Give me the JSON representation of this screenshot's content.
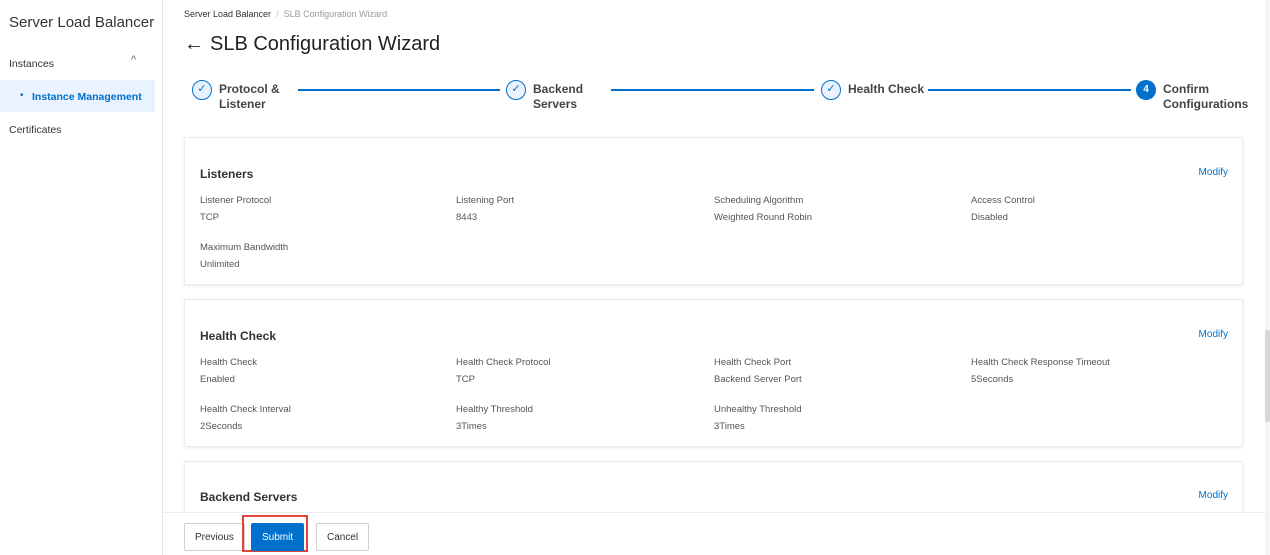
{
  "sidebar": {
    "title": "Server Load Balancer",
    "group_label": "Instances",
    "group_chevron": "^",
    "active_item": "Instance Management",
    "item_certificates": "Certificates"
  },
  "breadcrumb": {
    "root": "Server Load Balancer",
    "separator": "/",
    "current": "SLB Configuration Wizard"
  },
  "page": {
    "back_arrow": "←",
    "title": "SLB Configuration Wizard"
  },
  "steps": [
    {
      "line1": "Protocol &",
      "line2": "Listener",
      "status": "done",
      "icon": "✓"
    },
    {
      "line1": "Backend",
      "line2": "Servers",
      "status": "done",
      "icon": "✓"
    },
    {
      "line1": "Health Check",
      "line2": "",
      "status": "done",
      "icon": "✓"
    },
    {
      "line1": "Confirm",
      "line2": "Configurations",
      "status": "active",
      "icon": "4"
    }
  ],
  "listeners": {
    "title": "Listeners",
    "modify": "Modify",
    "fields": [
      {
        "label": "Listener Protocol",
        "value": "TCP"
      },
      {
        "label": "Listening Port",
        "value": "8443"
      },
      {
        "label": "Scheduling Algorithm",
        "value": "Weighted Round Robin"
      },
      {
        "label": "Access Control",
        "value": "Disabled"
      },
      {
        "label": "Maximum Bandwidth",
        "value": "Unlimited"
      }
    ]
  },
  "health_check": {
    "title": "Health Check",
    "modify": "Modify",
    "fields": [
      {
        "label": "Health Check",
        "value": "Enabled"
      },
      {
        "label": "Health Check Protocol",
        "value": "TCP"
      },
      {
        "label": "Health Check Port",
        "value": "Backend Server Port"
      },
      {
        "label": "Health Check Response Timeout",
        "value": "5Seconds"
      },
      {
        "label": "Health Check Interval",
        "value": "2Seconds"
      },
      {
        "label": "Healthy Threshold",
        "value": "3Times"
      },
      {
        "label": "Unhealthy Threshold",
        "value": "3Times"
      }
    ]
  },
  "backend_servers": {
    "title": "Backend Servers",
    "modify": "Modify"
  },
  "footer": {
    "previous": "Previous",
    "submit": "Submit",
    "cancel": "Cancel"
  },
  "colors": {
    "accent": "#0070cc",
    "highlight_border": "#e0433a"
  }
}
